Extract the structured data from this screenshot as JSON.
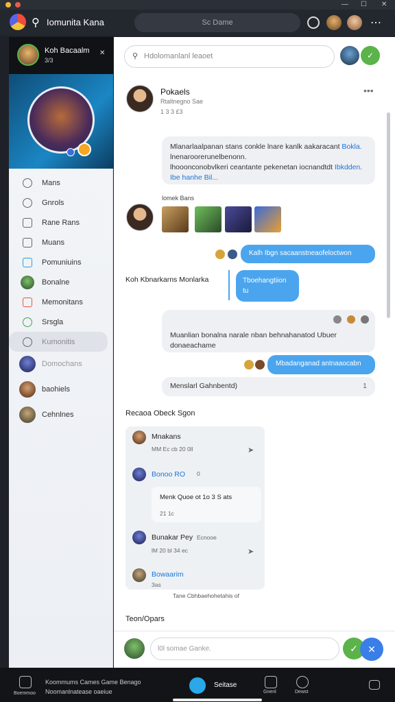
{
  "topbar": {
    "title": "Iomunita Kana",
    "search_placeholder": "Sc Dame"
  },
  "sidebar": {
    "profile_name": "Koh Bacaalm",
    "profile_sub": "3/3",
    "nav": [
      {
        "label": "Mans",
        "icon": "search-icon"
      },
      {
        "label": "Gnrols",
        "icon": "people-icon"
      },
      {
        "label": "Rane Rans",
        "icon": "bookmark-icon"
      },
      {
        "label": "Muans",
        "icon": "home-icon"
      },
      {
        "label": "Pomuniuins",
        "icon": "media-icon"
      },
      {
        "label": "Bonalne",
        "icon": "avatar"
      },
      {
        "label": "Memonitans",
        "icon": "calendar-icon"
      },
      {
        "label": "Srsgla",
        "icon": "phone-icon"
      },
      {
        "label": "Kumonitis",
        "icon": "edit-icon",
        "active": true
      }
    ],
    "people": [
      "Domochans",
      "baohiels",
      "Cehnlnes"
    ]
  },
  "main": {
    "search_placeholder": "Hdolomanlanl leaoet",
    "post": {
      "name": "Pokaels",
      "sub": "Rtaltnegno Sae",
      "meta": "1  3  3  £3"
    },
    "message1": {
      "text": "Mlanarlaalpanan stans conkle lnare kanlk aakaracant",
      "text2": "lnenaroorerunelbenonn.",
      "text3": "lhooonconobvlkeri ceantante pekenetan iocnandtdt",
      "link1": "Bokla.",
      "link2": "Ibkdden.",
      "link3": "Ibe hanhe Bil..."
    },
    "gallery_label": "lomek Bans",
    "blue1": "Kalh Ibgn sacaanstneaofeloctwon",
    "label_left": "Koh Kbnarkarns Monlarka",
    "blue2_line1": "Tboehangtiion",
    "blue2_line2": "tu",
    "grey2": "Muanlian bonalna narale nban behnahanatod Ubuer",
    "grey2_line2": "donaeachame",
    "blue3": "Mbadanganad antnaaocabn",
    "grey3": "Menslarl Gahnbentd)",
    "grey3_count": "1",
    "section_title": "Recaoa Obeck Sgon",
    "thread": [
      {
        "name": "Mnakans",
        "meta": "MM  Ec  cb  20 0ll"
      },
      {
        "name": "Bonoo RO",
        "meta": "0"
      },
      {
        "name": "Menk Quoe  ot  1o  3  S  ats",
        "meta": "21  1c"
      },
      {
        "name": "Bunakar Pey",
        "sub": "Ecnooe",
        "meta": "lM  20  bl  34  ec"
      },
      {
        "name": "Bowaarim",
        "meta": "3as"
      }
    ],
    "note": "Tane   Cbhbaehohetahis of",
    "footer_title": "Teon/Opars",
    "composer_placeholder": "l0l somae Ganke."
  },
  "bottombar": {
    "left_label": "Boemmoo",
    "text_line1": "Koommums Cames Game Benago",
    "text_line2": "Noomanlnatease oaeiue",
    "center": "Seitase",
    "right1": "Gnenl",
    "right2": "Dewst"
  },
  "colors": {
    "accent_blue": "#4aa5ee",
    "accent_green": "#5bb34a",
    "link": "#1a73d9"
  }
}
